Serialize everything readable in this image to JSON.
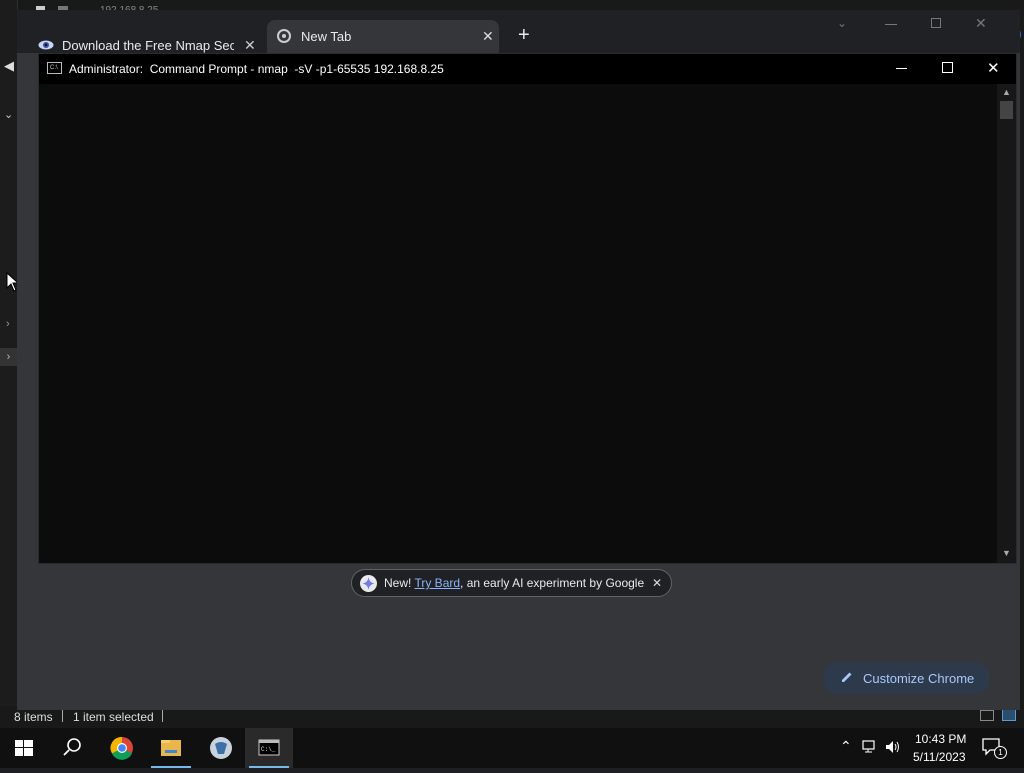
{
  "explorer": {
    "address_fragment": "192.168.8.25",
    "status_items": "8 items",
    "status_selected": "1 item selected"
  },
  "chrome": {
    "tabs": [
      {
        "label": "Download the Free Nmap Securi",
        "icon": "nmap-eye-icon"
      },
      {
        "label": "New Tab",
        "icon": "chrome-icon"
      }
    ],
    "new_tab_symbol": "+",
    "bard_banner": {
      "prefix": "New! ",
      "link": "Try Bard",
      "suffix": ", an early AI experiment by Google"
    },
    "customize_label": "Customize Chrome"
  },
  "cmd": {
    "title": "Administrator:  Command Prompt - nmap  -sV -p1-65535 192.168.8.25"
  },
  "taskbar": {
    "time": "10:43 PM",
    "date": "5/11/2023",
    "notification_count": "1",
    "apps": [
      "start-icon",
      "search-icon",
      "chrome-icon",
      "file-explorer-icon",
      "wireshark-icon",
      "cmd-icon"
    ]
  },
  "colors": {
    "accent_link": "#8ab4f8",
    "customize_text": "#a8c7fa",
    "cmd_bg": "#0c0c0c"
  }
}
